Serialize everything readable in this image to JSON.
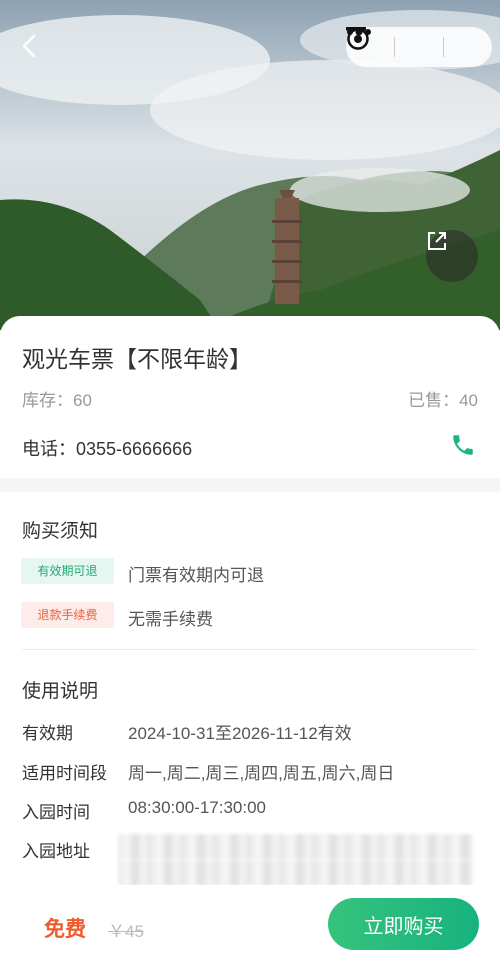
{
  "hero": {
    "image_alt": "mountain pagoda with mist",
    "back_icon": "chevron-left-icon",
    "share_icon": "external-link-icon"
  },
  "capsule": {
    "more_icon": "more-dots-icon",
    "minimize_icon": "minus-icon",
    "close_icon": "target-circle-icon"
  },
  "ticket": {
    "title": "观光车票【不限年龄】",
    "stock": "库存：60",
    "sold": "已售：40",
    "phone": "电话：0355-6666666"
  },
  "notice": {
    "title": "购买须知",
    "items": [
      {
        "tag": "有效期可退",
        "text": "门票有效期内可退"
      },
      {
        "tag": "退款手续费",
        "text": "无需手续费"
      }
    ]
  },
  "usage": {
    "title": "使用说明",
    "rows": [
      {
        "label": "有效期",
        "value": "2024-10-31至2026-11-12有效"
      },
      {
        "label": "适用时间段",
        "value": "周一,周二,周三,周四,周五,周六,周日"
      },
      {
        "label": "入园时间",
        "value": "08:30:00-17:30:00"
      },
      {
        "label": "入园地址",
        "value": ""
      }
    ]
  },
  "bottom_bar": {
    "price": "免费",
    "original_price": "￥45",
    "buy_label": "立即购买"
  },
  "colors": {
    "accent_green": "#1fb47f",
    "price_red": "#f15a2b"
  }
}
